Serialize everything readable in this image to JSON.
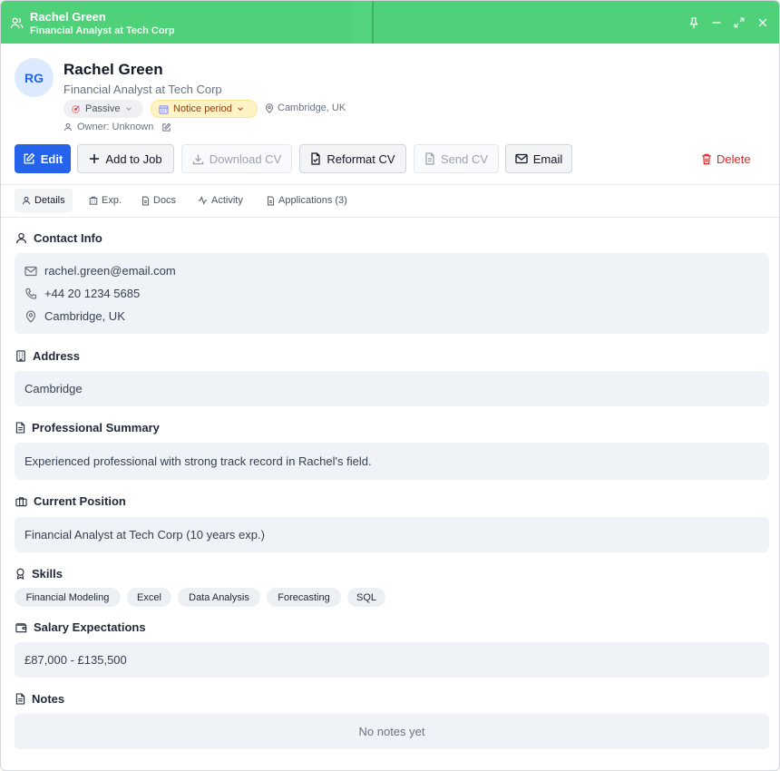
{
  "titlebar": {
    "name": "Rachel Green",
    "subtitle": "Financial Analyst at Tech Corp"
  },
  "candidate": {
    "initials": "RG",
    "name": "Rachel Green",
    "title": "Financial Analyst at Tech Corp",
    "status": "Passive",
    "availability": "Notice period",
    "location": "Cambridge, UK",
    "owner": "Owner: Unknown"
  },
  "actions": {
    "edit": "Edit",
    "add_to_job": "Add to Job",
    "download_cv": "Download CV",
    "reformat_cv": "Reformat CV",
    "send_cv": "Send CV",
    "email": "Email",
    "delete": "Delete"
  },
  "tabs": [
    {
      "label": "Details",
      "icon": "person-icon"
    },
    {
      "label": "Exp.",
      "icon": "building-icon"
    },
    {
      "label": "Docs",
      "icon": "document-icon"
    },
    {
      "label": "Activity",
      "icon": "activity-icon"
    },
    {
      "label": "Applications (3)",
      "icon": "document-icon"
    }
  ],
  "sections": {
    "contact": {
      "heading": "Contact Info",
      "email": "rachel.green@email.com",
      "phone": "+44 20 1234 5685",
      "location": "Cambridge, UK"
    },
    "address": {
      "heading": "Address",
      "value": "Cambridge"
    },
    "summary": {
      "heading": "Professional Summary",
      "value": "Experienced professional with strong track record in Rachel's field."
    },
    "position": {
      "heading": "Current Position",
      "value": "Financial Analyst at Tech Corp (10 years exp.)"
    },
    "skills": {
      "heading": "Skills",
      "items": [
        "Financial Modeling",
        "Excel",
        "Data Analysis",
        "Forecasting",
        "SQL"
      ]
    },
    "salary": {
      "heading": "Salary Expectations",
      "value": "£87,000 - £135,500"
    },
    "notes": {
      "heading": "Notes",
      "empty": "No notes yet"
    }
  },
  "colors": {
    "titlebar": "#4fd17a",
    "primary": "#2563eb",
    "danger": "#dc2626",
    "notice_bg": "#fef3c7"
  }
}
